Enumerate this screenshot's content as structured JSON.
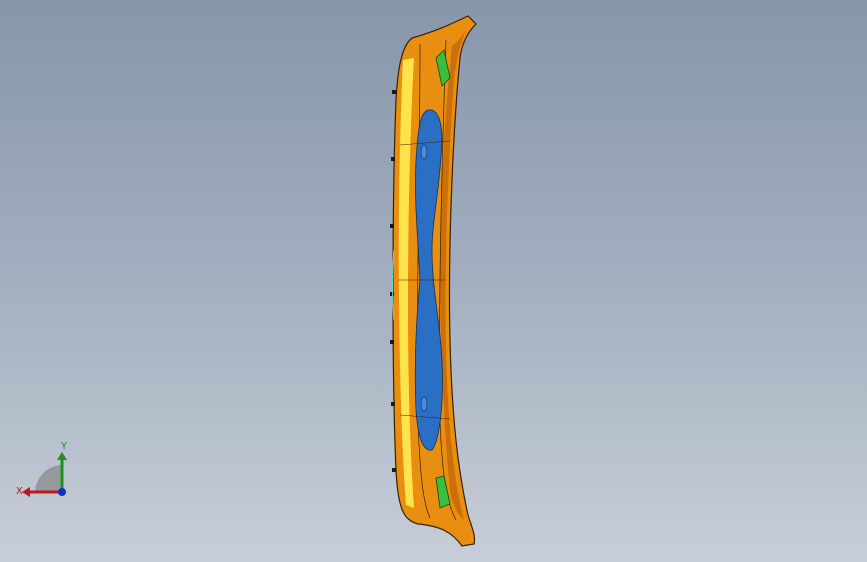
{
  "viewport": {
    "background_top": "#8796ab",
    "background_bottom": "#c7ced8"
  },
  "model": {
    "name": "bumper-part-model",
    "colors": {
      "body": "#e88e10",
      "body_dark": "#c46a08",
      "highlight": "#ffe34a",
      "cavity": "#2a6fc4",
      "insert": "#3dbd3d",
      "edge": "#3a2000"
    }
  },
  "triad": {
    "x_label": "X",
    "y_label": "Y",
    "x_color": "#c01818",
    "y_color": "#1f8f1f",
    "z_color": "#1030c8"
  }
}
